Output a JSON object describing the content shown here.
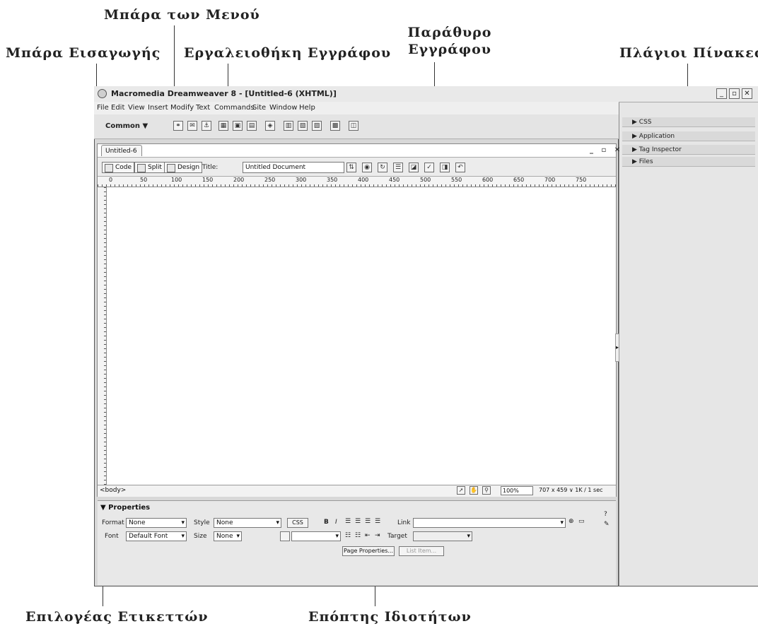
{
  "callouts": {
    "menubar": "Μπάρα των Μενού",
    "insertbar": "Μπάρα Εισαγωγής",
    "doctoolbar": "Εργαλειοθήκη Εγγράφου",
    "docwindow_line1": "Παράθυρο",
    "docwindow_line2": "Εγγράφου",
    "panels": "Πλάγιοι Πίνακες",
    "tagselector": "Επιλογέας Ετικεττών",
    "propinspector": "Επόπτης Ιδιοτήτων"
  },
  "window": {
    "title": "Macromedia Dreamweaver 8 - [Untitled-6 (XHTML)]",
    "minimize": "_",
    "maximize": "▫",
    "close": "✕"
  },
  "menu": [
    "File",
    "Edit",
    "View",
    "Insert",
    "Modify",
    "Text",
    "Commands",
    "Site",
    "Window",
    "Help"
  ],
  "insertbar": {
    "category": "Common ▼",
    "icons": [
      "hyperlink-icon",
      "email-link-icon",
      "named-anchor-icon",
      "table-icon",
      "layer-icon",
      "image-icon",
      "media-icon",
      "date-icon",
      "comment-icon",
      "templates-icon",
      "tag-chooser-icon"
    ]
  },
  "document": {
    "tab": "Untitled-6",
    "window_controls": "_ ▫ ✕",
    "view_buttons": [
      "Code",
      "Split",
      "Design"
    ],
    "title_label": "Title:",
    "title_value": "Untitled Document",
    "ruler_marks": [
      "0",
      "50",
      "100",
      "150",
      "200",
      "250",
      "300",
      "350",
      "400",
      "450",
      "500",
      "550",
      "600",
      "650",
      "700",
      "750"
    ]
  },
  "statusbar": {
    "tag": "<body>",
    "zoom": "100%",
    "dims": "707 x 459 ∨  1K / 1 sec"
  },
  "properties": {
    "header": "▼ Properties",
    "format_label": "Format",
    "format_value": "None",
    "style_label": "Style",
    "style_value": "None",
    "css_button": "CSS",
    "bold": "B",
    "italic": "I",
    "link_label": "Link",
    "font_label": "Font",
    "font_value": "Default Font",
    "size_label": "Size",
    "size_value": "None",
    "target_label": "Target",
    "page_properties": "Page Properties...",
    "list_item": "List Item..."
  },
  "panels": [
    "▶ CSS",
    "▶ Application",
    "▶ Tag Inspector",
    "▶ Files"
  ]
}
